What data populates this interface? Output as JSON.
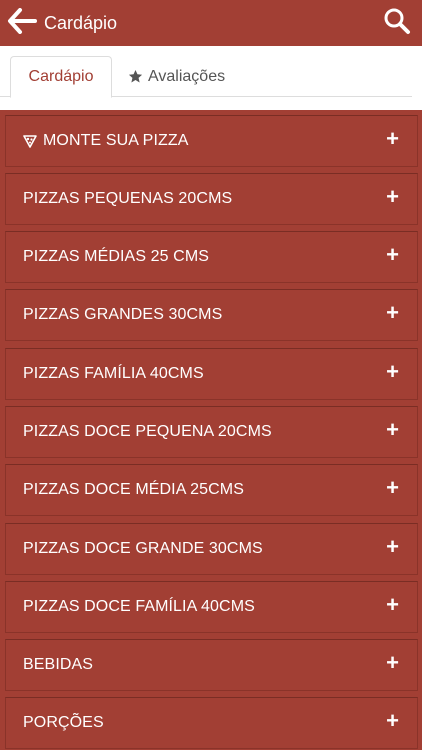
{
  "header": {
    "title": "Cardápio",
    "back_icon": "arrow-left-icon",
    "search_icon": "search-icon"
  },
  "tabs": [
    {
      "label": "Cardápio",
      "active": true
    },
    {
      "label": "Avaliações",
      "icon": "star-icon",
      "active": false
    }
  ],
  "menu": {
    "expand_symbol": "+",
    "items": [
      {
        "label": "MONTE SUA PIZZA",
        "icon": "pizza-slice-icon"
      },
      {
        "label": "PIZZAS PEQUENAS 20CMS"
      },
      {
        "label": "PIZZAS MÉDIAS 25 CMS"
      },
      {
        "label": "PIZZAS GRANDES 30CMS"
      },
      {
        "label": "PIZZAS FAMÍLIA 40CMS"
      },
      {
        "label": "PIZZAS DOCE PEQUENA 20CMS"
      },
      {
        "label": "PIZZAS DOCE MÉDIA 25CMS"
      },
      {
        "label": "PIZZAS DOCE GRANDE 30CMS"
      },
      {
        "label": "PIZZAS DOCE FAMÍLIA 40CMS"
      },
      {
        "label": "BEBIDAS"
      },
      {
        "label": "PORÇÕES"
      }
    ]
  },
  "colors": {
    "brand": "#a23f34",
    "tab_active_text": "#a23f34",
    "tab_inactive_text": "#555555"
  }
}
